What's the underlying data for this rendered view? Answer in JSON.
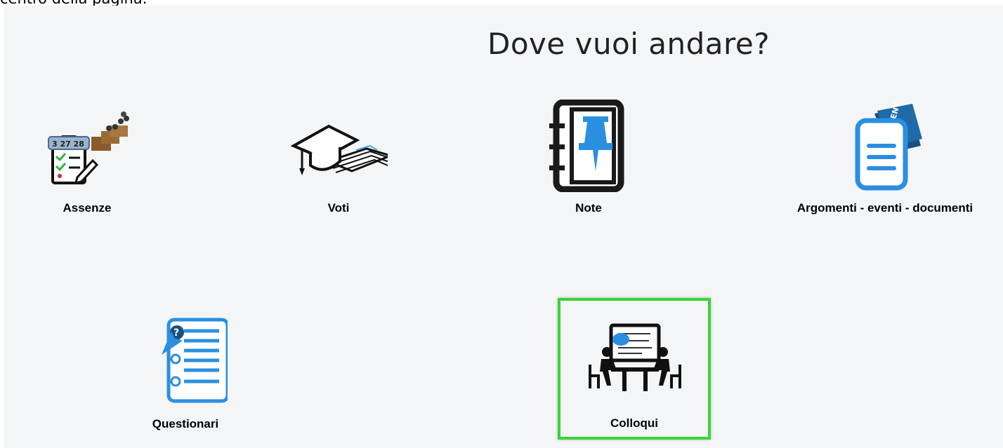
{
  "caption": "centro della pagina.",
  "page": {
    "title": "Dove vuoi andare?"
  },
  "tiles": [
    {
      "label": "Assenze",
      "icon": "attendance-calendar-icon"
    },
    {
      "label": "Voti",
      "icon": "graduation-cap-icon"
    },
    {
      "label": "Note",
      "icon": "notebook-pin-icon"
    },
    {
      "label": "Argomenti - eventi - documenti",
      "icon": "document-event-ticket-icon"
    },
    {
      "label": "Questionari",
      "icon": "questionnaire-list-icon"
    },
    {
      "label": "Colloqui",
      "icon": "meeting-whiteboard-icon"
    }
  ],
  "colors": {
    "accent": "#1e90e6",
    "highlight": "#3ad33a",
    "background": "#f4f5f7"
  },
  "highlighted_tile": "Colloqui"
}
